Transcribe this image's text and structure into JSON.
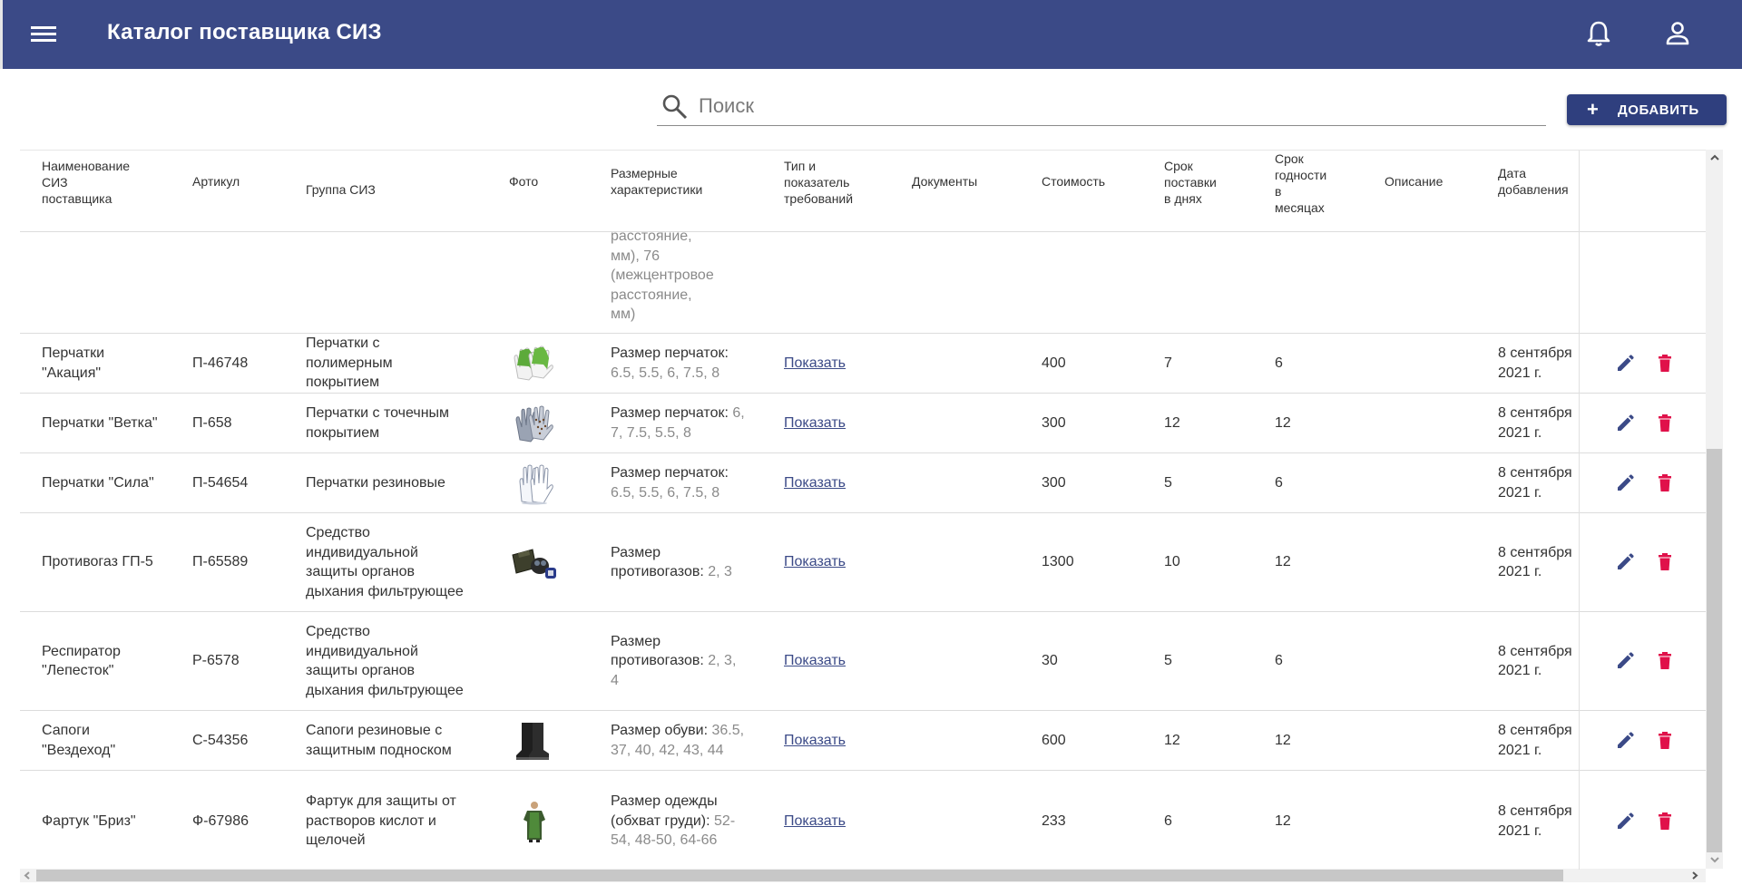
{
  "app": {
    "title": "Каталог поставщика СИЗ"
  },
  "search": {
    "placeholder": "Поиск",
    "value": ""
  },
  "toolbar": {
    "add_label": "ДОБАВИТЬ"
  },
  "columns": [
    "Наименование\nСИЗ\nпоставщика",
    "Артикул",
    "Группа СИЗ",
    "Фото",
    "Размерные\nхарактеристики",
    "Тип и\nпоказатель\nтребований",
    "Документы",
    "Стоимость",
    "Срок\nпоставки\nв днях",
    "Срок\nгодности\nв\nмесяцах",
    "Описание",
    "Дата\nдобавления"
  ],
  "partial_row": {
    "size_text": "расстояние,\nмм), 76\n(межцентровое\nрасстояние,\nмм)"
  },
  "rows": [
    {
      "name": "Перчатки \"Акация\"",
      "article": "П-46748",
      "group": "Перчатки с полимерным покрытием",
      "photo": "gloves-green-icon",
      "size_name": "Размер перчаток:",
      "size_values": "6.5, 5.5, 6, 7.5, 8",
      "link": "Показать",
      "price": "400",
      "delivery": "7",
      "shelf": "6",
      "date": "8 сентября 2021 г."
    },
    {
      "name": "Перчатки \"Ветка\"",
      "article": "П-658",
      "group": "Перчатки с точечным покрытием",
      "photo": "gloves-dotted-icon",
      "size_name": "Размер перчаток:",
      "size_values": "6, 7, 7.5, 5.5, 8",
      "link": "Показать",
      "price": "300",
      "delivery": "12",
      "shelf": "12",
      "date": "8 сентября 2021 г."
    },
    {
      "name": "Перчатки \"Сила\"",
      "article": "П-54654",
      "group": "Перчатки резиновые",
      "photo": "gloves-white-icon",
      "size_name": "Размер перчаток:",
      "size_values": "6.5, 5.5, 6, 7.5, 8",
      "link": "Показать",
      "price": "300",
      "delivery": "5",
      "shelf": "6",
      "date": "8 сентября 2021 г."
    },
    {
      "name": "Противогаз ГП-5",
      "article": "П-65589",
      "group": "Средство индивидуальной защиты органов дыхания фильтрующее",
      "photo": "gas-mask-icon",
      "size_name": "Размер противогазов:",
      "size_values": "2, 3",
      "link": "Показать",
      "price": "1300",
      "delivery": "10",
      "shelf": "12",
      "date": "8 сентября 2021 г."
    },
    {
      "name": "Респиратор \"Лепесток\"",
      "article": "Р-6578",
      "group": "Средство индивидуальной защиты органов дыхания фильтрующее",
      "photo": "",
      "size_name": "Размер противогазов:",
      "size_values": "2, 3, 4",
      "link": "Показать",
      "price": "30",
      "delivery": "5",
      "shelf": "6",
      "date": "8 сентября 2021 г."
    },
    {
      "name": "Сапоги \"Вездеход\"",
      "article": "С-54356",
      "group": "Сапоги резиновые с защитным подноском",
      "photo": "boots-icon",
      "size_name": "Размер обуви:",
      "size_values": "36.5, 37, 40, 42, 43, 44",
      "link": "Показать",
      "price": "600",
      "delivery": "12",
      "shelf": "12",
      "date": "8 сентября 2021 г."
    },
    {
      "name": "Фартук \"Бриз\"",
      "article": "Ф-67986",
      "group": "Фартук для защиты от растворов кислот и щелочей",
      "photo": "apron-icon",
      "size_name": "Размер одежды (обхват груди):",
      "size_values": "52-54, 48-50, 64-66",
      "link": "Показать",
      "price": "233",
      "delivery": "6",
      "shelf": "12",
      "date": "8 сентября 2021 г."
    }
  ],
  "colors": {
    "appbar": "#3b4a87",
    "button": "#2f3f7e",
    "edit": "#3b4a87",
    "delete": "#e0114a",
    "muted": "#8a8a8a"
  }
}
